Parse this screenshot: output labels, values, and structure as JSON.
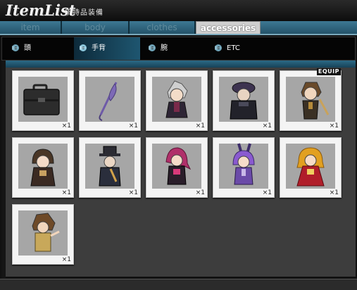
{
  "header": {
    "logo": "ItemList",
    "subtitle": "所持品装備"
  },
  "category_tabs": [
    {
      "label": "item",
      "active": false
    },
    {
      "label": "body",
      "active": false
    },
    {
      "label": "clothes",
      "active": false
    },
    {
      "label": "accessories",
      "active": true
    }
  ],
  "sub_tabs": [
    {
      "label": "頭",
      "active": false,
      "icon": "gear-arrow-icon"
    },
    {
      "label": "手背",
      "active": true,
      "icon": "gear-arrow-icon"
    },
    {
      "label": "腕",
      "active": false,
      "icon": "gear-arrow-icon"
    },
    {
      "label": "ETC",
      "active": false,
      "icon": "gear-arrow-icon"
    }
  ],
  "items": [
    {
      "name": "briefcase",
      "qty": "×1",
      "equipped": false
    },
    {
      "name": "umbrella",
      "qty": "×1",
      "equipped": false
    },
    {
      "name": "chibi-white-hair-coat",
      "qty": "×1",
      "equipped": false
    },
    {
      "name": "chibi-dark-hat-cape",
      "qty": "×1",
      "equipped": false
    },
    {
      "name": "chibi-brown-hair-staff",
      "qty": "×1",
      "equipped": true
    },
    {
      "name": "chibi-hooded-girl",
      "qty": "×1",
      "equipped": false
    },
    {
      "name": "chibi-top-hat-gentleman",
      "qty": "×1",
      "equipped": false
    },
    {
      "name": "chibi-pink-hair-girl",
      "qty": "×1",
      "equipped": false
    },
    {
      "name": "chibi-purple-bunny-girl",
      "qty": "×1",
      "equipped": false
    },
    {
      "name": "chibi-red-dress-girl",
      "qty": "×1",
      "equipped": false
    },
    {
      "name": "chibi-brown-hair-boy",
      "qty": "×1",
      "equipped": false
    }
  ],
  "equip_badge": "EQUIP"
}
